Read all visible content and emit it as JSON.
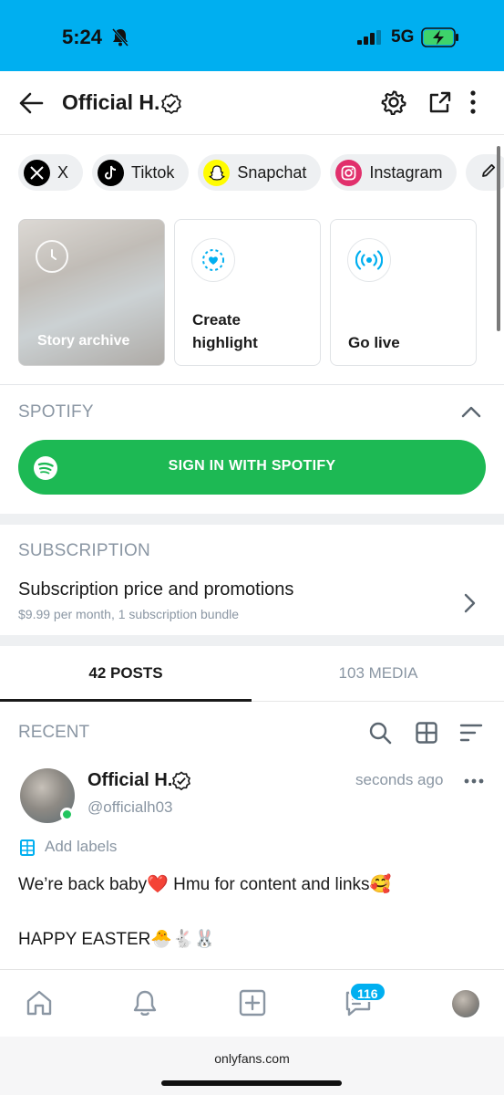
{
  "status_bar": {
    "time": "5:24",
    "network": "5G",
    "bell_icon": "bell-slash-icon"
  },
  "header": {
    "title": "Official H.",
    "icons": [
      "back-arrow-icon",
      "settings-icon",
      "share-icon",
      "more-vertical-icon"
    ]
  },
  "socials": [
    {
      "label": "X",
      "icon": "x-logo-icon",
      "color": "#000000"
    },
    {
      "label": "Tiktok",
      "icon": "tiktok-logo-icon",
      "color": "#000000"
    },
    {
      "label": "Snapchat",
      "icon": "snapchat-logo-icon",
      "color": "#fffc00"
    },
    {
      "label": "Instagram",
      "icon": "instagram-logo-icon",
      "color": "#e1306c"
    }
  ],
  "stories": {
    "archive": "Story archive",
    "create_line1": "Create",
    "create_line2": "highlight",
    "live": "Go live"
  },
  "spotify": {
    "title": "SPOTIFY",
    "button": "SIGN IN WITH SPOTIFY",
    "color": "#1db954"
  },
  "subscription": {
    "title": "SUBSCRIPTION",
    "row_title": "Subscription price and promotions",
    "row_detail": "$9.99 per month, 1 subscription bundle"
  },
  "tabs": {
    "posts": "42 POSTS",
    "media": "103 MEDIA"
  },
  "recent": {
    "title": "RECENT"
  },
  "post": {
    "name": "Official H.",
    "handle": "@officialh03",
    "time": "seconds ago",
    "labels": "Add labels",
    "line1": "We’re back baby❤️ Hmu for content and links🥰",
    "line2": "HAPPY EASTER🐣🐇🐰"
  },
  "bottom_nav": {
    "messages_badge": "116"
  },
  "browser": {
    "url": "onlyfans.com"
  },
  "colors": {
    "accent": "#00aff0",
    "muted": "#8a96a3"
  }
}
